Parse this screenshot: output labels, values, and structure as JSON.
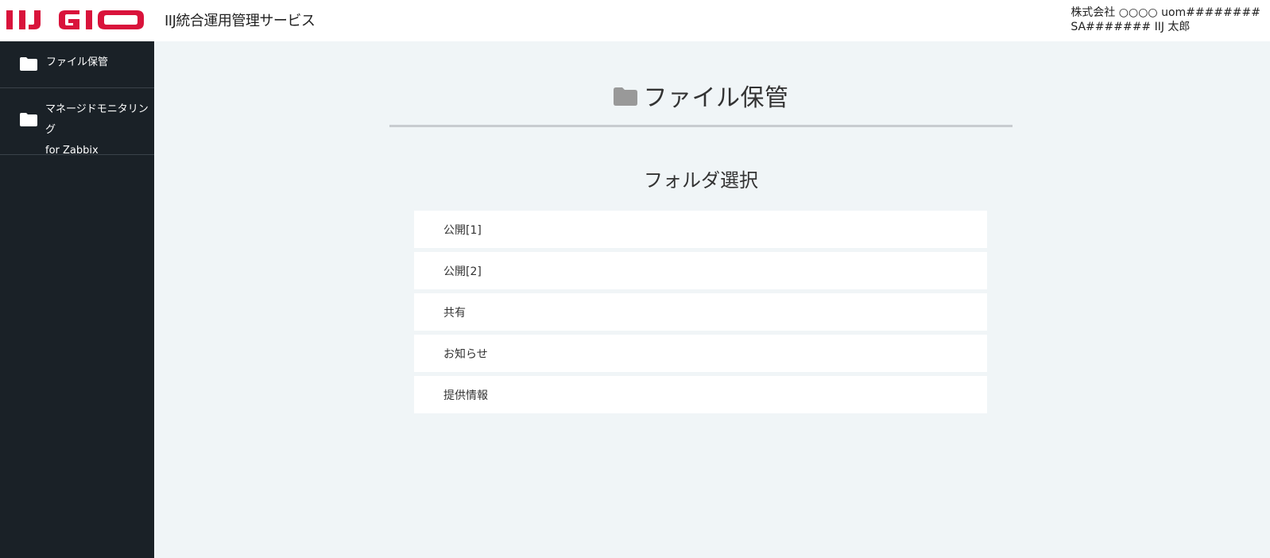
{
  "header": {
    "logo_text": "IIJ GIO",
    "service_name": "IIJ統合運用管理サービス",
    "user_line1": "株式会社 ○○○○ uom########",
    "user_line2": "SA####### IIJ 太郎",
    "brand_color": "#d9133b"
  },
  "sidebar": {
    "items": [
      {
        "icon": "folder-icon",
        "label_line1": "ファイル保管",
        "label_line2": ""
      },
      {
        "icon": "folder-icon",
        "label_line1": "マネージドモニタリング",
        "label_line2": "for Zabbix"
      }
    ]
  },
  "main": {
    "title": "ファイル保管",
    "title_icon": "folder-icon",
    "subtitle": "フォルダ選択",
    "folders": [
      "公開[1]",
      "公開[2]",
      "共有",
      "お知らせ",
      "提供情報"
    ]
  }
}
